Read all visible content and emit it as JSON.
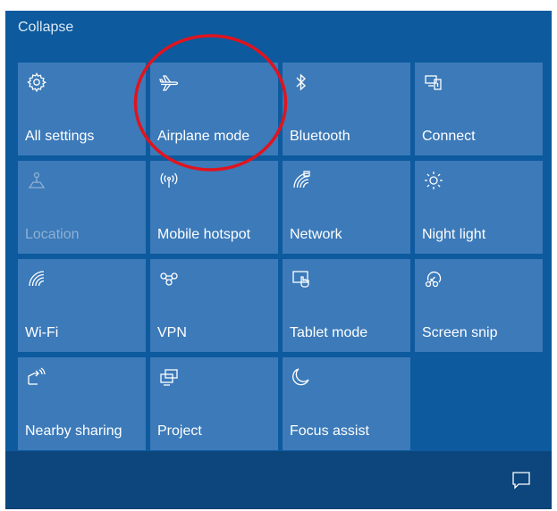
{
  "header": {
    "collapse_label": "Collapse"
  },
  "tiles": [
    {
      "label": "All settings",
      "icon": "gear-icon",
      "disabled": false
    },
    {
      "label": "Airplane mode",
      "icon": "airplane-icon",
      "disabled": false
    },
    {
      "label": "Bluetooth",
      "icon": "bluetooth-icon",
      "disabled": false
    },
    {
      "label": "Connect",
      "icon": "connect-icon",
      "disabled": false
    },
    {
      "label": "Location",
      "icon": "location-icon",
      "disabled": true
    },
    {
      "label": "Mobile hotspot",
      "icon": "hotspot-icon",
      "disabled": false
    },
    {
      "label": "Network",
      "icon": "network-icon",
      "disabled": false
    },
    {
      "label": "Night light",
      "icon": "sun-icon",
      "disabled": false
    },
    {
      "label": "Wi-Fi",
      "icon": "wifi-icon",
      "disabled": false
    },
    {
      "label": "VPN",
      "icon": "vpn-icon",
      "disabled": false
    },
    {
      "label": "Tablet mode",
      "icon": "tablet-mode-icon",
      "disabled": false
    },
    {
      "label": "Screen snip",
      "icon": "screen-snip-icon",
      "disabled": false
    },
    {
      "label": "Nearby sharing",
      "icon": "nearby-sharing-icon",
      "disabled": false
    },
    {
      "label": "Project",
      "icon": "project-icon",
      "disabled": false
    },
    {
      "label": "Focus assist",
      "icon": "moon-icon",
      "disabled": false
    }
  ],
  "footer": {
    "notifications_icon": "notifications-icon"
  },
  "colors": {
    "panel": "#0d5a9e",
    "tile": "#3c7ab9",
    "bottom_bar": "#0c467d",
    "annotation": "#e0141e"
  }
}
